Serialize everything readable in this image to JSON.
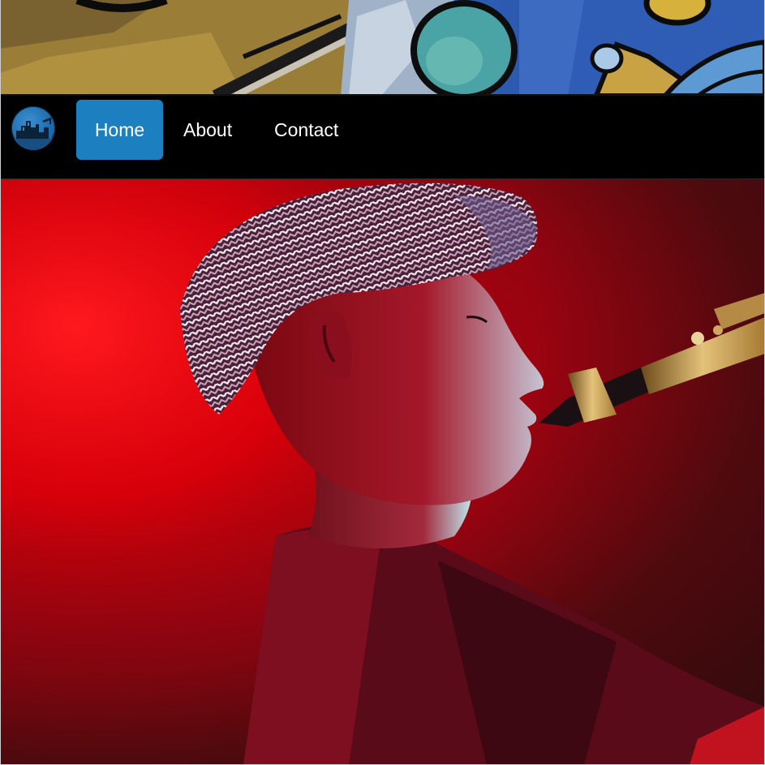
{
  "nav": {
    "logo_icon": "site-logo-icon",
    "items": [
      {
        "label": "Home",
        "active": true
      },
      {
        "label": "About",
        "active": false
      },
      {
        "label": "Contact",
        "active": false
      }
    ]
  },
  "banner": {
    "image": "abstract-mural-banner"
  },
  "hero": {
    "image": "saxophone-player-red-light-photo"
  },
  "colors": {
    "nav_background": "#000000",
    "nav_active": "#1c7fc0",
    "nav_text": "#ffffff",
    "hero_light": "#ff0a12"
  }
}
